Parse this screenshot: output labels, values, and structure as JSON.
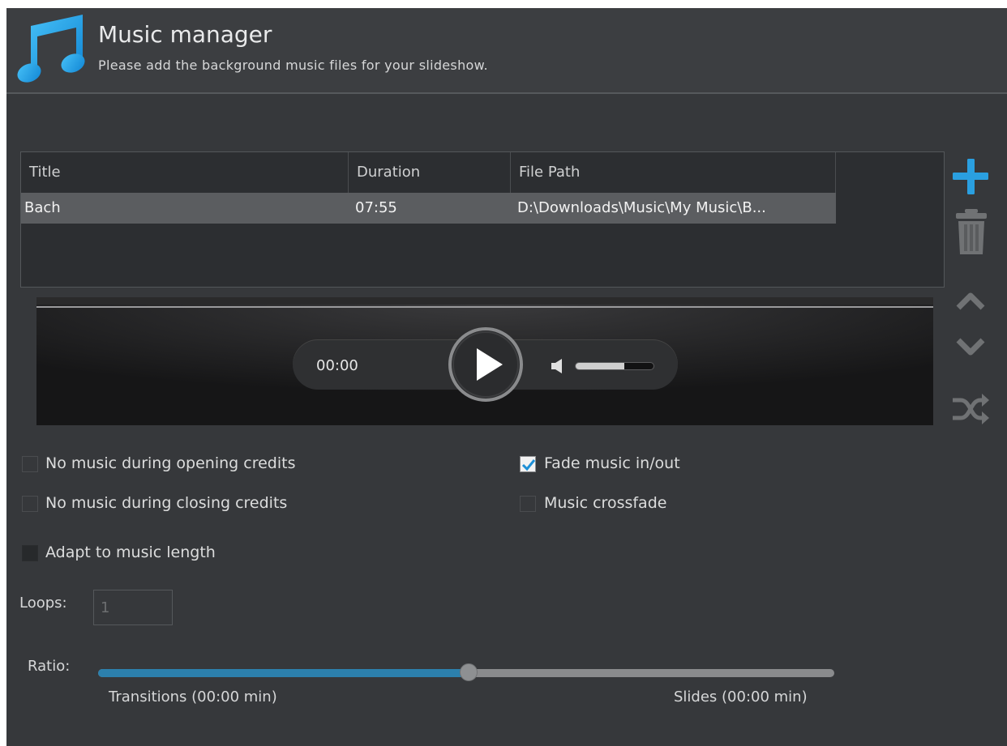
{
  "header": {
    "title": "Music manager",
    "subtitle": "Please add the background music files for your slideshow."
  },
  "table": {
    "columns": [
      "Title",
      "Duration",
      "File Path"
    ],
    "rows": [
      {
        "title": "Bach",
        "duration": "07:55",
        "path": "D:\\Downloads\\Music\\My Music\\B..."
      }
    ]
  },
  "player": {
    "time": "00:00",
    "volume": 0.62
  },
  "sidebar": {
    "icons": [
      "plus-icon",
      "trash-icon",
      "chevron-up-icon",
      "chevron-down-icon",
      "shuffle-icon"
    ],
    "accent": "#2a9fe0"
  },
  "options": {
    "no_music_opening": {
      "label": "No music during opening credits",
      "checked": false
    },
    "no_music_closing": {
      "label": "No music during closing credits",
      "checked": false
    },
    "adapt_length": {
      "label": "Adapt to music length",
      "checked": false
    },
    "fade": {
      "label": "Fade music in/out",
      "checked": true
    },
    "crossfade": {
      "label": "Music crossfade",
      "checked": false
    }
  },
  "loops": {
    "label": "Loops:",
    "value": "1"
  },
  "ratio": {
    "label": "Ratio:",
    "value": 0.5,
    "left_label": "Transitions (00:00 min)",
    "right_label": "Slides (00:00 min)",
    "fill_color": "#2c80ad"
  }
}
